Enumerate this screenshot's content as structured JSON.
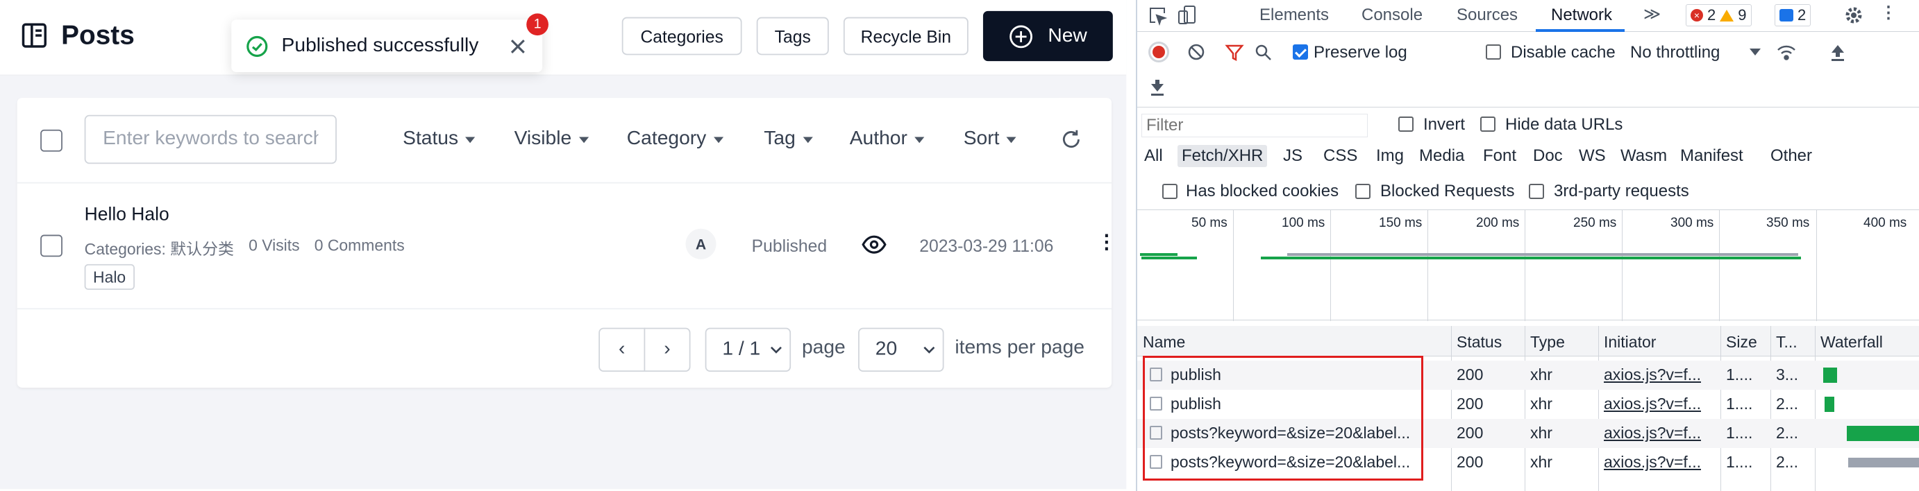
{
  "app": {
    "page_title": "Posts",
    "toast": {
      "message": "Published successfully",
      "badge": "1"
    },
    "header_buttons": {
      "categories": "Categories",
      "tags": "Tags",
      "recycle_bin": "Recycle Bin",
      "new": "New"
    },
    "search": {
      "placeholder": "Enter keywords to search"
    },
    "filters": {
      "status": "Status",
      "visible": "Visible",
      "category": "Category",
      "tag": "Tag",
      "author": "Author",
      "sort": "Sort"
    },
    "post": {
      "title": "Hello Halo",
      "categories": "Categories: 默认分类",
      "visits": "0 Visits",
      "comments": "0 Comments",
      "tag": "Halo",
      "author_initial": "A",
      "status": "Published",
      "date": "2023-03-29 11:06",
      "more": "⋮"
    },
    "pagination": {
      "prev": "‹",
      "next": "›",
      "page_select": "1 / 1",
      "page_label": "page",
      "size_select": "20",
      "size_label": "items per page"
    }
  },
  "devtools": {
    "tabs": [
      "Elements",
      "Console",
      "Sources",
      "Network"
    ],
    "overflow": "≫",
    "counters": {
      "errors": "2",
      "warnings": "9",
      "messages": "2"
    },
    "toolbar": {
      "preserve_log": "Preserve log",
      "disable_cache": "Disable cache",
      "throttling": "No throttling"
    },
    "filter": {
      "placeholder": "Filter",
      "invert": "Invert",
      "hide_data_urls": "Hide data URLs"
    },
    "types": [
      "All",
      "Fetch/XHR",
      "JS",
      "CSS",
      "Img",
      "Media",
      "Font",
      "Doc",
      "WS",
      "Wasm",
      "Manifest",
      "Other"
    ],
    "options": {
      "blocked_cookies": "Has blocked cookies",
      "blocked_requests": "Blocked Requests",
      "third_party": "3rd-party requests"
    },
    "timeline_ticks": [
      "50 ms",
      "100 ms",
      "150 ms",
      "200 ms",
      "250 ms",
      "300 ms",
      "350 ms",
      "400 ms"
    ],
    "columns": [
      "Name",
      "Status",
      "Type",
      "Initiator",
      "Size",
      "T...",
      "Waterfall"
    ],
    "requests": [
      {
        "name": "publish",
        "status": "200",
        "type": "xhr",
        "initiator": "axios.js?v=f...",
        "size": "1....",
        "time": "3..."
      },
      {
        "name": "publish",
        "status": "200",
        "type": "xhr",
        "initiator": "axios.js?v=f...",
        "size": "1....",
        "time": "2..."
      },
      {
        "name": "posts?keyword=&size=20&label...",
        "status": "200",
        "type": "xhr",
        "initiator": "axios.js?v=f...",
        "size": "1....",
        "time": "2..."
      },
      {
        "name": "posts?keyword=&size=20&label...",
        "status": "200",
        "type": "xhr",
        "initiator": "axios.js?v=f...",
        "size": "1....",
        "time": "2..."
      }
    ]
  },
  "colors": {
    "accent": "#1a73e8",
    "success": "#16a34a",
    "error": "#d93025",
    "highlight": "#e01e1e",
    "primary_button": "#0b1324"
  }
}
